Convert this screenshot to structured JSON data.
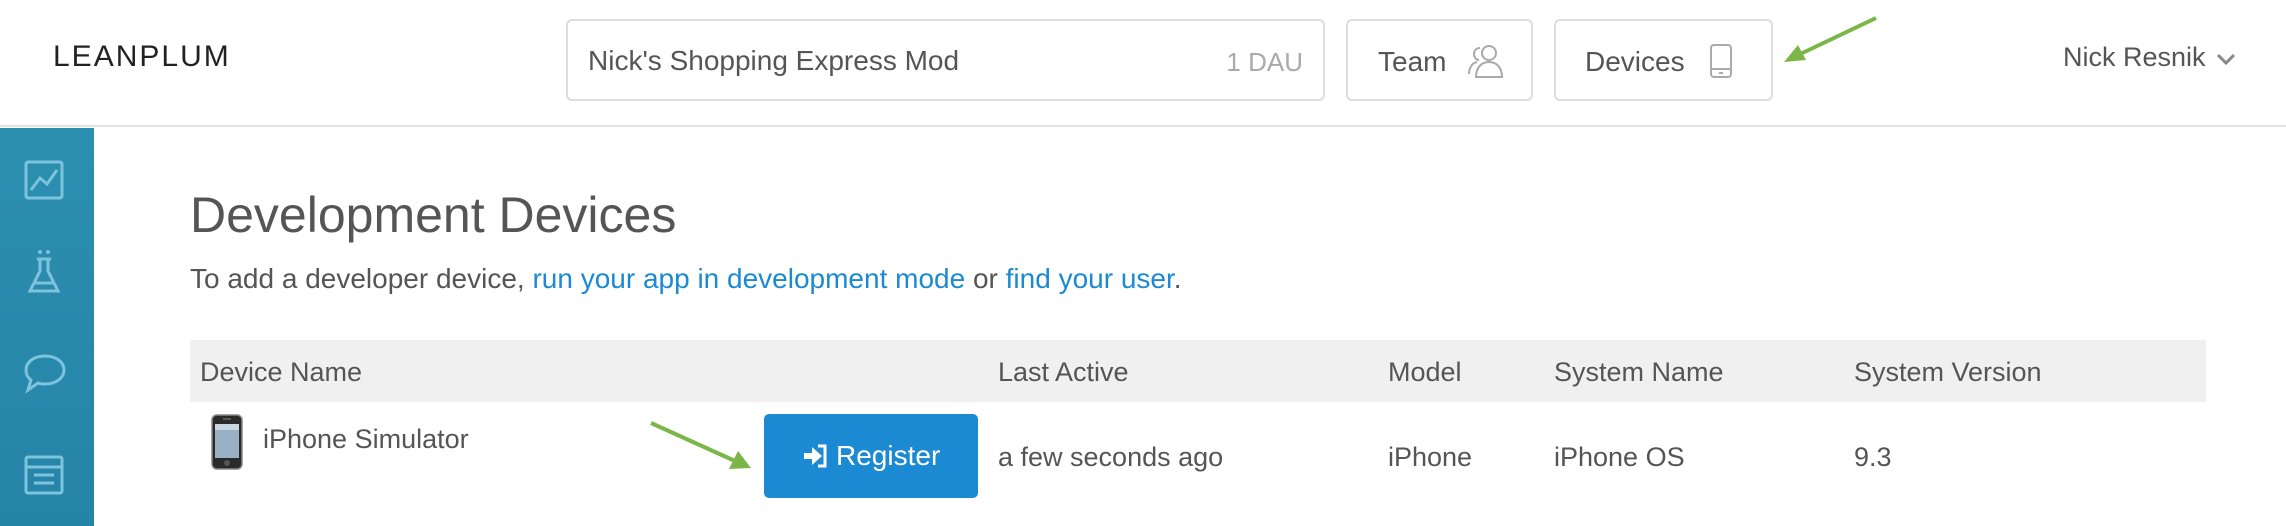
{
  "header": {
    "logo": "LEANPLUM",
    "app_selector": {
      "name": "Nick's Shopping Express Mod",
      "dau": "1 DAU"
    },
    "team_label": "Team",
    "devices_label": "Devices",
    "user_name": "Nick Resnik"
  },
  "sidebar": {
    "items": [
      {
        "icon": "analytics-icon"
      },
      {
        "icon": "ab-test-flask-icon"
      },
      {
        "icon": "messaging-chat-icon"
      },
      {
        "icon": "content-layout-icon"
      }
    ]
  },
  "main": {
    "title": "Development Devices",
    "subtitle": {
      "prefix": "To add a developer device, ",
      "link1": "run your app in development mode",
      "middle": " or ",
      "link2": "find your user",
      "suffix": "."
    },
    "table": {
      "columns": [
        "Device Name",
        "Last Active",
        "Model",
        "System Name",
        "System Version"
      ],
      "rows": [
        {
          "device_name": "iPhone Simulator",
          "register_label": "Register",
          "last_active": "a few seconds ago",
          "model": "iPhone",
          "system_name": "iPhone OS",
          "system_version": "9.3"
        }
      ]
    }
  },
  "colors": {
    "accent": "#1b8ad3",
    "sidebar": "#2a8aae",
    "annotation_arrow": "#7ab648"
  }
}
